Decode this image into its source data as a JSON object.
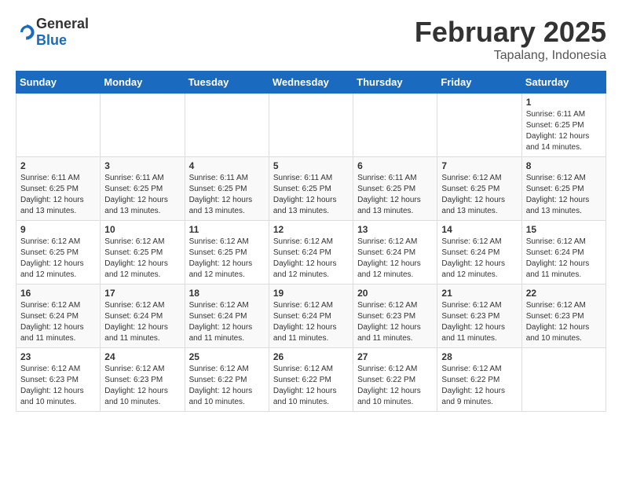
{
  "header": {
    "logo_general": "General",
    "logo_blue": "Blue",
    "month": "February 2025",
    "location": "Tapalang, Indonesia"
  },
  "weekdays": [
    "Sunday",
    "Monday",
    "Tuesday",
    "Wednesday",
    "Thursday",
    "Friday",
    "Saturday"
  ],
  "weeks": [
    [
      {
        "day": "",
        "info": ""
      },
      {
        "day": "",
        "info": ""
      },
      {
        "day": "",
        "info": ""
      },
      {
        "day": "",
        "info": ""
      },
      {
        "day": "",
        "info": ""
      },
      {
        "day": "",
        "info": ""
      },
      {
        "day": "1",
        "info": "Sunrise: 6:11 AM\nSunset: 6:25 PM\nDaylight: 12 hours\nand 14 minutes."
      }
    ],
    [
      {
        "day": "2",
        "info": "Sunrise: 6:11 AM\nSunset: 6:25 PM\nDaylight: 12 hours\nand 13 minutes."
      },
      {
        "day": "3",
        "info": "Sunrise: 6:11 AM\nSunset: 6:25 PM\nDaylight: 12 hours\nand 13 minutes."
      },
      {
        "day": "4",
        "info": "Sunrise: 6:11 AM\nSunset: 6:25 PM\nDaylight: 12 hours\nand 13 minutes."
      },
      {
        "day": "5",
        "info": "Sunrise: 6:11 AM\nSunset: 6:25 PM\nDaylight: 12 hours\nand 13 minutes."
      },
      {
        "day": "6",
        "info": "Sunrise: 6:11 AM\nSunset: 6:25 PM\nDaylight: 12 hours\nand 13 minutes."
      },
      {
        "day": "7",
        "info": "Sunrise: 6:12 AM\nSunset: 6:25 PM\nDaylight: 12 hours\nand 13 minutes."
      },
      {
        "day": "8",
        "info": "Sunrise: 6:12 AM\nSunset: 6:25 PM\nDaylight: 12 hours\nand 13 minutes."
      }
    ],
    [
      {
        "day": "9",
        "info": "Sunrise: 6:12 AM\nSunset: 6:25 PM\nDaylight: 12 hours\nand 12 minutes."
      },
      {
        "day": "10",
        "info": "Sunrise: 6:12 AM\nSunset: 6:25 PM\nDaylight: 12 hours\nand 12 minutes."
      },
      {
        "day": "11",
        "info": "Sunrise: 6:12 AM\nSunset: 6:25 PM\nDaylight: 12 hours\nand 12 minutes."
      },
      {
        "day": "12",
        "info": "Sunrise: 6:12 AM\nSunset: 6:24 PM\nDaylight: 12 hours\nand 12 minutes."
      },
      {
        "day": "13",
        "info": "Sunrise: 6:12 AM\nSunset: 6:24 PM\nDaylight: 12 hours\nand 12 minutes."
      },
      {
        "day": "14",
        "info": "Sunrise: 6:12 AM\nSunset: 6:24 PM\nDaylight: 12 hours\nand 12 minutes."
      },
      {
        "day": "15",
        "info": "Sunrise: 6:12 AM\nSunset: 6:24 PM\nDaylight: 12 hours\nand 11 minutes."
      }
    ],
    [
      {
        "day": "16",
        "info": "Sunrise: 6:12 AM\nSunset: 6:24 PM\nDaylight: 12 hours\nand 11 minutes."
      },
      {
        "day": "17",
        "info": "Sunrise: 6:12 AM\nSunset: 6:24 PM\nDaylight: 12 hours\nand 11 minutes."
      },
      {
        "day": "18",
        "info": "Sunrise: 6:12 AM\nSunset: 6:24 PM\nDaylight: 12 hours\nand 11 minutes."
      },
      {
        "day": "19",
        "info": "Sunrise: 6:12 AM\nSunset: 6:24 PM\nDaylight: 12 hours\nand 11 minutes."
      },
      {
        "day": "20",
        "info": "Sunrise: 6:12 AM\nSunset: 6:23 PM\nDaylight: 12 hours\nand 11 minutes."
      },
      {
        "day": "21",
        "info": "Sunrise: 6:12 AM\nSunset: 6:23 PM\nDaylight: 12 hours\nand 11 minutes."
      },
      {
        "day": "22",
        "info": "Sunrise: 6:12 AM\nSunset: 6:23 PM\nDaylight: 12 hours\nand 10 minutes."
      }
    ],
    [
      {
        "day": "23",
        "info": "Sunrise: 6:12 AM\nSunset: 6:23 PM\nDaylight: 12 hours\nand 10 minutes."
      },
      {
        "day": "24",
        "info": "Sunrise: 6:12 AM\nSunset: 6:23 PM\nDaylight: 12 hours\nand 10 minutes."
      },
      {
        "day": "25",
        "info": "Sunrise: 6:12 AM\nSunset: 6:22 PM\nDaylight: 12 hours\nand 10 minutes."
      },
      {
        "day": "26",
        "info": "Sunrise: 6:12 AM\nSunset: 6:22 PM\nDaylight: 12 hours\nand 10 minutes."
      },
      {
        "day": "27",
        "info": "Sunrise: 6:12 AM\nSunset: 6:22 PM\nDaylight: 12 hours\nand 10 minutes."
      },
      {
        "day": "28",
        "info": "Sunrise: 6:12 AM\nSunset: 6:22 PM\nDaylight: 12 hours\nand 9 minutes."
      },
      {
        "day": "",
        "info": ""
      }
    ]
  ]
}
